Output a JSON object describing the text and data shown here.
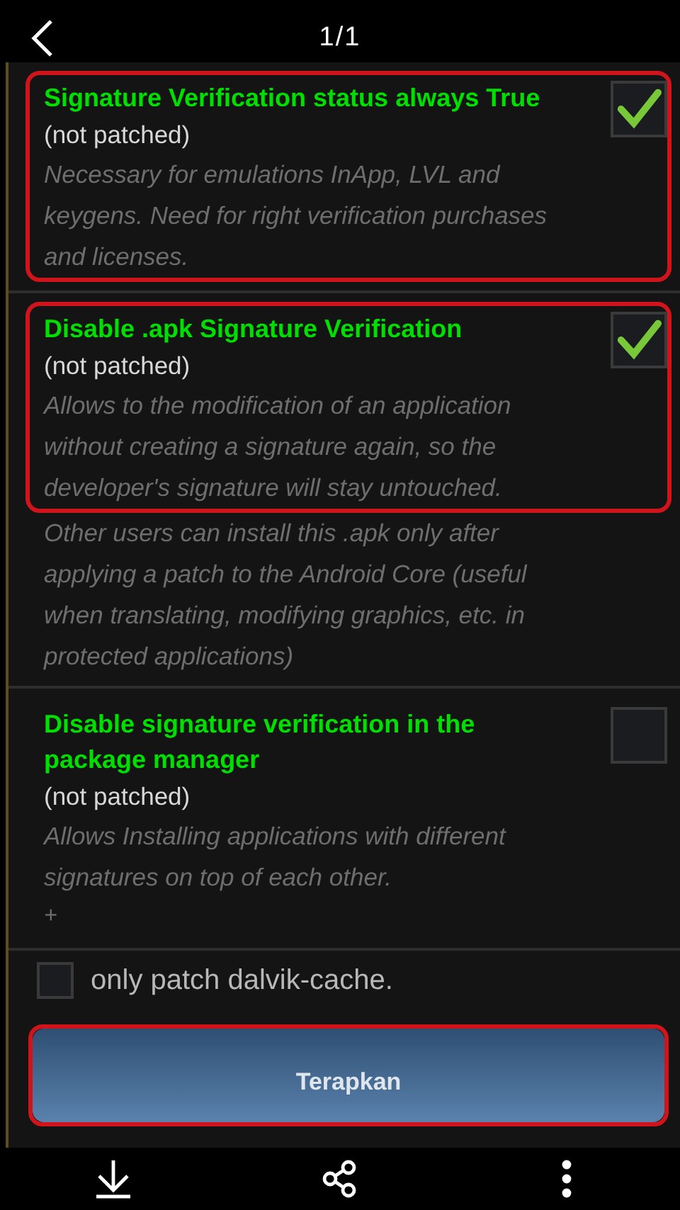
{
  "top_bar": {
    "back_icon": true,
    "counter": "1/1"
  },
  "items": [
    {
      "title": "Signature Verification status always True",
      "status": "(not patched)",
      "description": "Necessary for emulations InApp, LVL and keygens. Need for right verification purchases and licenses.",
      "checked": true,
      "highlighted": true
    },
    {
      "title": "Disable .apk Signature Verification",
      "status": "(not patched)",
      "description": "Allows to the modification of an application without creating a signature again, so the developer's signature will stay untouched.",
      "note": "Other users can install this .apk only after applying a patch to the Android Core (useful when translating, modifying graphics, etc. in protected applications)",
      "checked": true,
      "highlighted": true
    },
    {
      "title": "Disable signature verification in the package manager",
      "status": "(not patched)",
      "description": "Allows Installing applications with different signatures on top of each other.",
      "mark": "+",
      "checked": false,
      "highlighted": false
    }
  ],
  "dalvik_option": {
    "label": "only patch dalvik-cache.",
    "checked": false
  },
  "apply_button": {
    "label": "Terapkan",
    "highlighted": true
  },
  "bottom_bar": {
    "actions": [
      {
        "kind": "download"
      },
      {
        "kind": "share"
      },
      {
        "kind": "more"
      }
    ]
  }
}
